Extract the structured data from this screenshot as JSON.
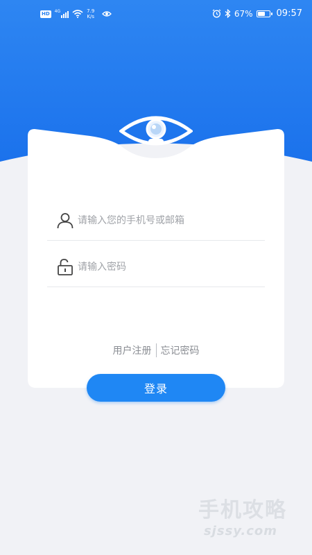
{
  "status_bar": {
    "hd_badge": "HD",
    "network": "4G",
    "net_speed_value": "7.9",
    "net_speed_unit": "K/s",
    "battery_percent": "67%",
    "battery_level": 0.67,
    "time": "09:57"
  },
  "login": {
    "account_placeholder": "请输入您的手机号或邮箱",
    "account_value": "",
    "password_placeholder": "请输入密码",
    "password_value": "",
    "register_link": "用户注册",
    "forgot_link": "忘记密码",
    "login_button": "登录"
  },
  "watermark": {
    "text": "手机攻略",
    "sub": "sjssy.com"
  },
  "colors": {
    "primary": "#1f87f4",
    "header_gradient_top": "#2a82f0",
    "header_gradient_bottom": "#1b73ec",
    "background": "#f1f2f6",
    "card": "#ffffff",
    "placeholder": "#a0a3a8",
    "link": "#8a8d93"
  }
}
